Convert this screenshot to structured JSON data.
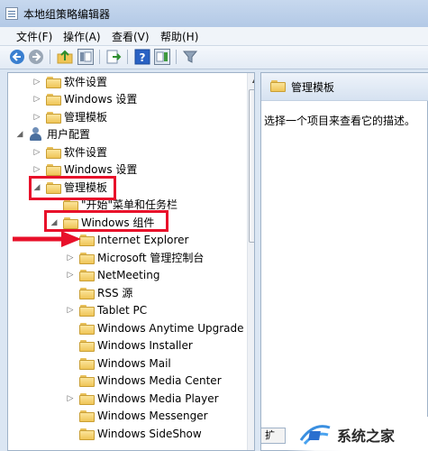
{
  "window": {
    "title": "本地组策略编辑器"
  },
  "menu": [
    {
      "label": "文件(F)"
    },
    {
      "label": "操作(A)"
    },
    {
      "label": "查看(V)"
    },
    {
      "label": "帮助(H)"
    }
  ],
  "toolbar": [
    {
      "icon": "back-arrow-icon"
    },
    {
      "icon": "forward-arrow-icon"
    },
    {
      "icon": "up-folder-icon"
    },
    {
      "icon": "show-hide-tree-icon"
    },
    {
      "icon": "export-list-icon"
    },
    {
      "icon": "help-icon"
    },
    {
      "icon": "show-hide-action-pane-icon"
    },
    {
      "icon": "filter-icon"
    }
  ],
  "tree": [
    {
      "label": "软件设置",
      "expander": "▷"
    },
    {
      "label": "Windows 设置",
      "expander": "▷"
    },
    {
      "label": "管理模板",
      "expander": "▷"
    },
    {
      "label": "用户配置",
      "expander": "◢"
    },
    {
      "label": "软件设置",
      "expander": "▷"
    },
    {
      "label": "Windows 设置",
      "expander": "▷"
    },
    {
      "label": "管理模板",
      "expander": "◢"
    },
    {
      "label": "\"开始\"菜单和任务栏",
      "expander": ""
    },
    {
      "label": "Windows 组件",
      "expander": "◢"
    },
    {
      "label": "Internet Explorer",
      "expander": ""
    },
    {
      "label": "Microsoft 管理控制台",
      "expander": "▷"
    },
    {
      "label": "NetMeeting",
      "expander": "▷"
    },
    {
      "label": "RSS 源",
      "expander": ""
    },
    {
      "label": "Tablet PC",
      "expander": "▷"
    },
    {
      "label": "Windows Anytime Upgrade",
      "expander": ""
    },
    {
      "label": "Windows Installer",
      "expander": ""
    },
    {
      "label": "Windows Mail",
      "expander": ""
    },
    {
      "label": "Windows Media Center",
      "expander": ""
    },
    {
      "label": "Windows Media Player",
      "expander": "▷"
    },
    {
      "label": "Windows Messenger",
      "expander": ""
    },
    {
      "label": "Windows SideShow",
      "expander": ""
    }
  ],
  "right_pane": {
    "header": "管理模板",
    "description": "选择一个项目来查看它的描述。",
    "tab_label": "扩"
  },
  "watermark": {
    "text": "系统之家"
  },
  "colors": {
    "highlight": "#e8102a",
    "accent": "#4a6f9e"
  }
}
